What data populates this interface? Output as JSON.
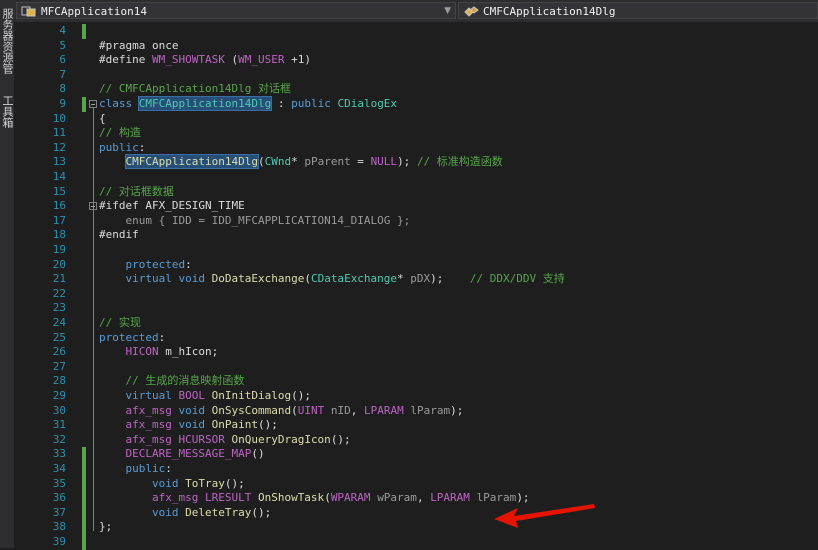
{
  "side_tabs": [
    {
      "text": "服务器资源管理器"
    },
    {
      "text": "工具箱"
    }
  ],
  "navigation": {
    "left_combo": "MFCApplication14",
    "right_combo": "CMFCApplication14Dlg"
  },
  "colors": {
    "background": "#1e1e1e",
    "keyword": "#569cd6",
    "comment": "#57a64a",
    "macro": "#bd63c5",
    "type": "#4ec9b0",
    "line_number": "#2b91af",
    "arrow": "#e51400"
  },
  "icons": {
    "left_combo": "class-scope-icon",
    "right_combo": "class-member-icon",
    "annotation": "red-arrow-icon"
  },
  "lines": [
    {
      "num": "4",
      "segs": []
    },
    {
      "num": "5",
      "segs": [
        {
          "t": "#pragma once",
          "c": ""
        }
      ]
    },
    {
      "num": "6",
      "segs": [
        {
          "t": "#define ",
          "c": ""
        },
        {
          "t": "WM_SHOWTASK",
          "c": "mc"
        },
        {
          "t": " (",
          "c": ""
        },
        {
          "t": "WM_USER",
          "c": "mc"
        },
        {
          "t": " +1)",
          "c": ""
        }
      ]
    },
    {
      "num": "7",
      "segs": []
    },
    {
      "num": "8",
      "segs": [
        {
          "t": "// CMFCApplication14Dlg 对话框",
          "c": "cm"
        }
      ]
    },
    {
      "num": "9",
      "segs": [
        {
          "t": "class ",
          "c": "kw"
        },
        {
          "t": "CMFCApplication14Dlg",
          "c": "ty hl"
        },
        {
          "t": " : ",
          "c": ""
        },
        {
          "t": "public",
          "c": "kw"
        },
        {
          "t": " ",
          "c": ""
        },
        {
          "t": "CDialogEx",
          "c": "ty"
        }
      ]
    },
    {
      "num": "10",
      "segs": [
        {
          "t": "{",
          "c": ""
        }
      ]
    },
    {
      "num": "11",
      "segs": [
        {
          "t": "// 构造",
          "c": "cm"
        }
      ]
    },
    {
      "num": "12",
      "segs": [
        {
          "t": "public",
          "c": "kw"
        },
        {
          "t": ":",
          "c": ""
        }
      ]
    },
    {
      "num": "13",
      "segs": [
        {
          "t": "    ",
          "c": ""
        },
        {
          "t": "CMFCApplication14Dlg",
          "c": "fn hl"
        },
        {
          "t": "(",
          "c": ""
        },
        {
          "t": "CWnd",
          "c": "ty"
        },
        {
          "t": "* ",
          "c": ""
        },
        {
          "t": "pParent",
          "c": "pm"
        },
        {
          "t": " = ",
          "c": ""
        },
        {
          "t": "NULL",
          "c": "mc"
        },
        {
          "t": "); ",
          "c": ""
        },
        {
          "t": "// 标准构造函数",
          "c": "cm"
        }
      ]
    },
    {
      "num": "14",
      "segs": []
    },
    {
      "num": "15",
      "segs": [
        {
          "t": "// 对话框数据",
          "c": "cm"
        }
      ]
    },
    {
      "num": "16",
      "segs": [
        {
          "t": "#ifdef ",
          "c": ""
        },
        {
          "t": "AFX_DESIGN_TIME",
          "c": ""
        }
      ]
    },
    {
      "num": "17",
      "segs": [
        {
          "t": "    enum { IDD = IDD_MFCAPPLICATION14_DIALOG };",
          "c": "pm"
        }
      ]
    },
    {
      "num": "18",
      "segs": [
        {
          "t": "#endif",
          "c": ""
        }
      ]
    },
    {
      "num": "19",
      "segs": []
    },
    {
      "num": "20",
      "segs": [
        {
          "t": "    ",
          "c": ""
        },
        {
          "t": "protected",
          "c": "kw"
        },
        {
          "t": ":",
          "c": ""
        }
      ]
    },
    {
      "num": "21",
      "segs": [
        {
          "t": "    ",
          "c": ""
        },
        {
          "t": "virtual",
          "c": "kw"
        },
        {
          "t": " ",
          "c": ""
        },
        {
          "t": "void",
          "c": "kw"
        },
        {
          "t": " ",
          "c": ""
        },
        {
          "t": "DoDataExchange",
          "c": "fn"
        },
        {
          "t": "(",
          "c": ""
        },
        {
          "t": "CDataExchange",
          "c": "ty"
        },
        {
          "t": "* ",
          "c": ""
        },
        {
          "t": "pDX",
          "c": "pm"
        },
        {
          "t": ");    ",
          "c": ""
        },
        {
          "t": "// DDX/DDV 支持",
          "c": "cm"
        }
      ]
    },
    {
      "num": "22",
      "segs": []
    },
    {
      "num": "23",
      "segs": []
    },
    {
      "num": "24",
      "segs": [
        {
          "t": "// 实现",
          "c": "cm"
        }
      ]
    },
    {
      "num": "25",
      "segs": [
        {
          "t": "protected",
          "c": "kw"
        },
        {
          "t": ":",
          "c": ""
        }
      ]
    },
    {
      "num": "26",
      "segs": [
        {
          "t": "    ",
          "c": ""
        },
        {
          "t": "HICON",
          "c": "mc"
        },
        {
          "t": " m_hIcon;",
          "c": ""
        }
      ]
    },
    {
      "num": "27",
      "segs": []
    },
    {
      "num": "28",
      "segs": [
        {
          "t": "    ",
          "c": ""
        },
        {
          "t": "// 生成的消息映射函数",
          "c": "cm"
        }
      ]
    },
    {
      "num": "29",
      "segs": [
        {
          "t": "    ",
          "c": ""
        },
        {
          "t": "virtual",
          "c": "kw"
        },
        {
          "t": " ",
          "c": ""
        },
        {
          "t": "BOOL",
          "c": "mc"
        },
        {
          "t": " ",
          "c": ""
        },
        {
          "t": "OnInitDialog",
          "c": "fn"
        },
        {
          "t": "();",
          "c": ""
        }
      ]
    },
    {
      "num": "30",
      "segs": [
        {
          "t": "    ",
          "c": ""
        },
        {
          "t": "afx_msg",
          "c": "mc"
        },
        {
          "t": " ",
          "c": ""
        },
        {
          "t": "void",
          "c": "kw"
        },
        {
          "t": " ",
          "c": ""
        },
        {
          "t": "OnSysCommand",
          "c": "fn"
        },
        {
          "t": "(",
          "c": ""
        },
        {
          "t": "UINT",
          "c": "mc"
        },
        {
          "t": " ",
          "c": ""
        },
        {
          "t": "nID",
          "c": "pm"
        },
        {
          "t": ", ",
          "c": ""
        },
        {
          "t": "LPARAM",
          "c": "mc"
        },
        {
          "t": " ",
          "c": ""
        },
        {
          "t": "lParam",
          "c": "pm"
        },
        {
          "t": ");",
          "c": ""
        }
      ]
    },
    {
      "num": "31",
      "segs": [
        {
          "t": "    ",
          "c": ""
        },
        {
          "t": "afx_msg",
          "c": "mc"
        },
        {
          "t": " ",
          "c": ""
        },
        {
          "t": "void",
          "c": "kw"
        },
        {
          "t": " ",
          "c": ""
        },
        {
          "t": "OnPaint",
          "c": "fn"
        },
        {
          "t": "();",
          "c": ""
        }
      ]
    },
    {
      "num": "32",
      "segs": [
        {
          "t": "    ",
          "c": ""
        },
        {
          "t": "afx_msg",
          "c": "mc"
        },
        {
          "t": " ",
          "c": ""
        },
        {
          "t": "HCURSOR",
          "c": "mc"
        },
        {
          "t": " ",
          "c": ""
        },
        {
          "t": "OnQueryDragIcon",
          "c": "fn"
        },
        {
          "t": "();",
          "c": ""
        }
      ]
    },
    {
      "num": "33",
      "segs": [
        {
          "t": "    ",
          "c": ""
        },
        {
          "t": "DECLARE_MESSAGE_MAP",
          "c": "mc"
        },
        {
          "t": "()",
          "c": ""
        }
      ]
    },
    {
      "num": "34",
      "segs": [
        {
          "t": "    ",
          "c": ""
        },
        {
          "t": "public",
          "c": "kw"
        },
        {
          "t": ":",
          "c": ""
        }
      ]
    },
    {
      "num": "35",
      "segs": [
        {
          "t": "        ",
          "c": ""
        },
        {
          "t": "void",
          "c": "kw"
        },
        {
          "t": " ",
          "c": ""
        },
        {
          "t": "ToTray",
          "c": "fn"
        },
        {
          "t": "();",
          "c": ""
        }
      ]
    },
    {
      "num": "36",
      "segs": [
        {
          "t": "        ",
          "c": ""
        },
        {
          "t": "afx_msg",
          "c": "mc"
        },
        {
          "t": " ",
          "c": ""
        },
        {
          "t": "LRESULT",
          "c": "mc"
        },
        {
          "t": " ",
          "c": ""
        },
        {
          "t": "OnShowTask",
          "c": "fn"
        },
        {
          "t": "(",
          "c": ""
        },
        {
          "t": "WPARAM",
          "c": "mc"
        },
        {
          "t": " ",
          "c": ""
        },
        {
          "t": "wParam",
          "c": "pm"
        },
        {
          "t": ", ",
          "c": ""
        },
        {
          "t": "LPARAM",
          "c": "mc"
        },
        {
          "t": " ",
          "c": ""
        },
        {
          "t": "lParam",
          "c": "pm"
        },
        {
          "t": ");",
          "c": ""
        }
      ]
    },
    {
      "num": "37",
      "segs": [
        {
          "t": "        ",
          "c": ""
        },
        {
          "t": "void",
          "c": "kw"
        },
        {
          "t": " ",
          "c": ""
        },
        {
          "t": "DeleteTray",
          "c": "fn"
        },
        {
          "t": "();",
          "c": ""
        }
      ]
    },
    {
      "num": "38",
      "segs": [
        {
          "t": "};",
          "c": ""
        }
      ]
    },
    {
      "num": "39",
      "segs": []
    }
  ]
}
